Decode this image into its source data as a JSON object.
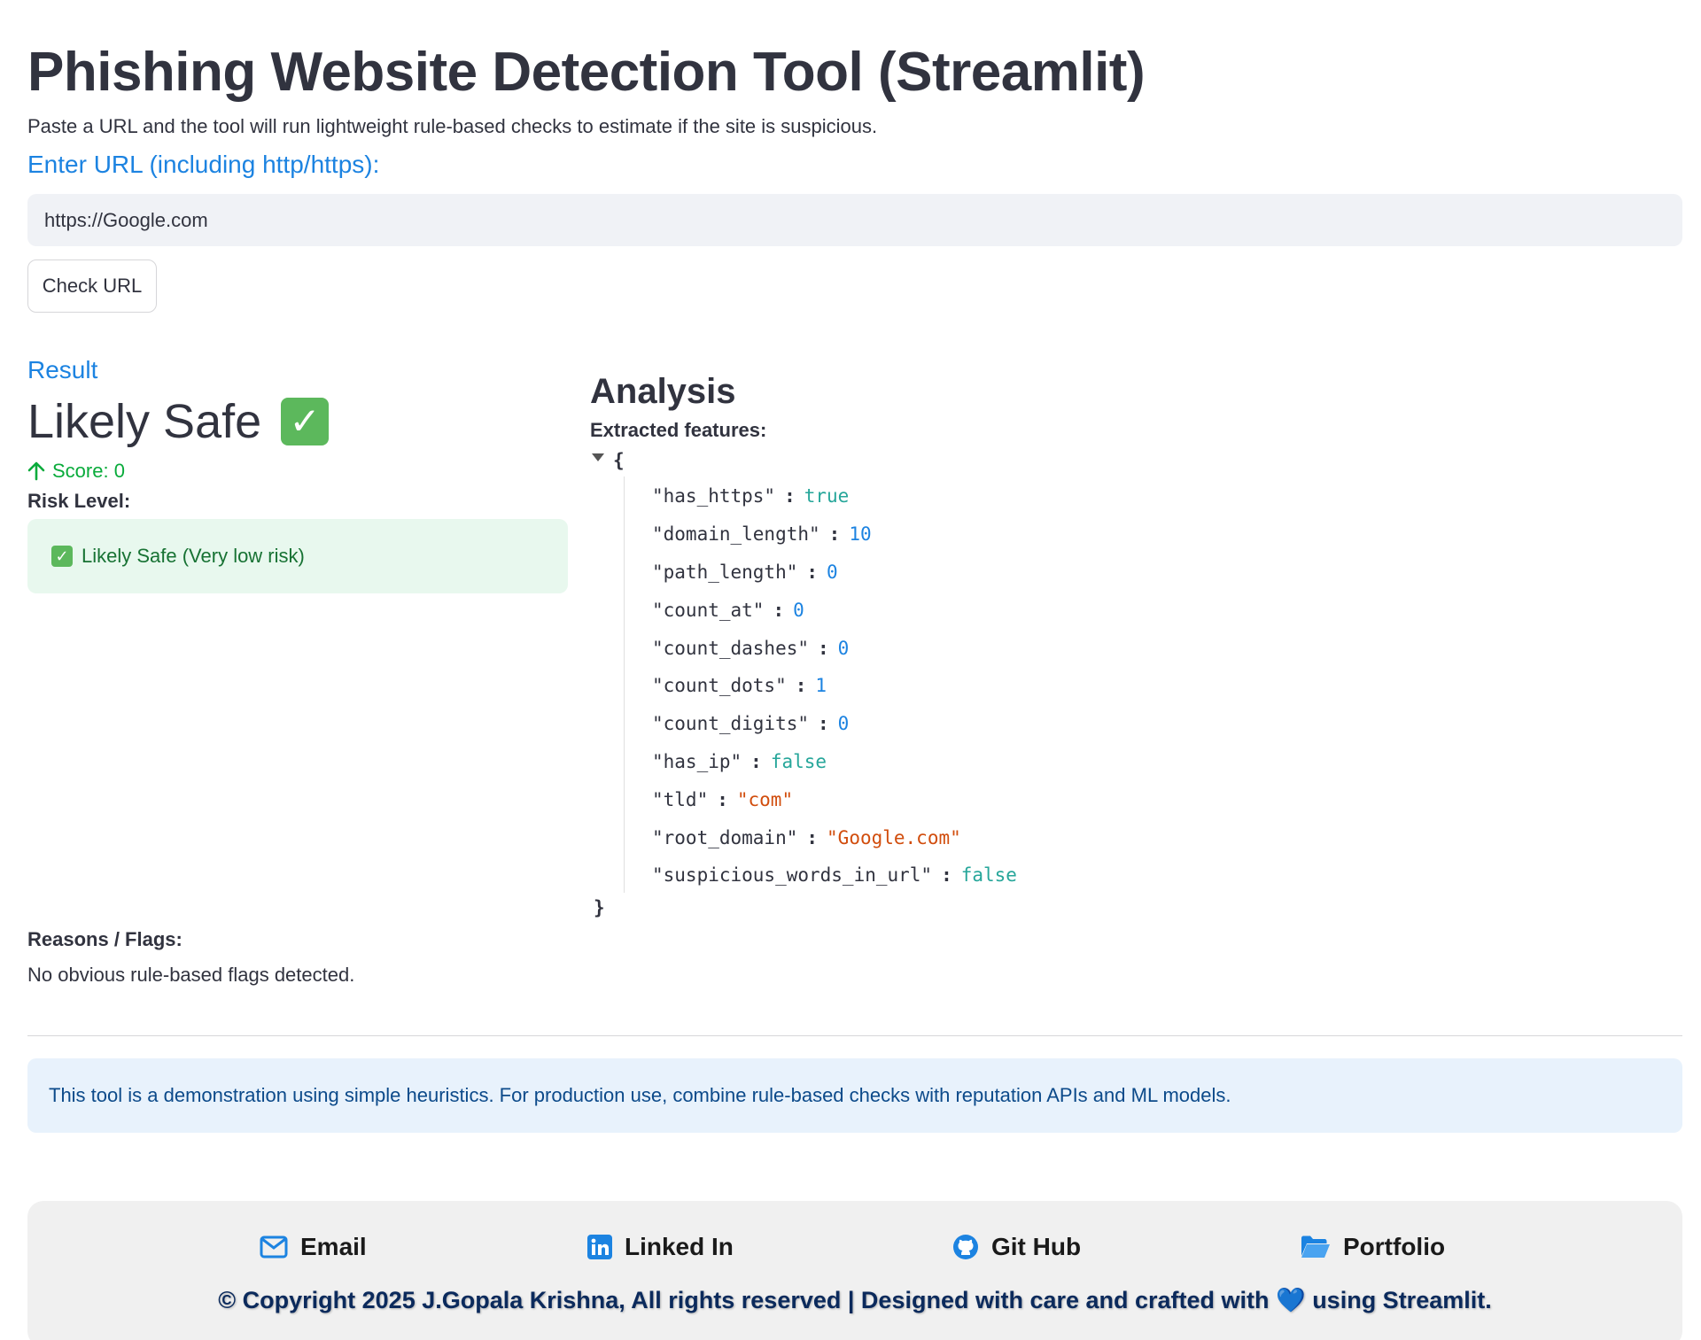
{
  "header": {
    "title": "Phishing Website Detection Tool (Streamlit)",
    "subtitle": "Paste a URL and the tool will run lightweight rule-based checks to estimate if the site is suspicious."
  },
  "url_input": {
    "label": "Enter URL (including http/https):",
    "value": "https://Google.com"
  },
  "check_button": {
    "label": "Check URL"
  },
  "result": {
    "label": "Result",
    "value": "Likely Safe",
    "score": "Score: 0",
    "risk_label": "Risk Level:",
    "risk_text": "Likely Safe (Very low risk)"
  },
  "analysis": {
    "title": "Analysis",
    "features_label": "Extracted features:",
    "features": [
      {
        "key": "\"has_https\"",
        "value": "true",
        "type": "bool"
      },
      {
        "key": "\"domain_length\"",
        "value": "10",
        "type": "num"
      },
      {
        "key": "\"path_length\"",
        "value": "0",
        "type": "num"
      },
      {
        "key": "\"count_at\"",
        "value": "0",
        "type": "num"
      },
      {
        "key": "\"count_dashes\"",
        "value": "0",
        "type": "num"
      },
      {
        "key": "\"count_dots\"",
        "value": "1",
        "type": "num"
      },
      {
        "key": "\"count_digits\"",
        "value": "0",
        "type": "num"
      },
      {
        "key": "\"has_ip\"",
        "value": "false",
        "type": "bool"
      },
      {
        "key": "\"tld\"",
        "value": "\"com\"",
        "type": "str"
      },
      {
        "key": "\"root_domain\"",
        "value": "\"Google.com\"",
        "type": "str"
      },
      {
        "key": "\"suspicious_words_in_url\"",
        "value": "false",
        "type": "bool"
      }
    ]
  },
  "reasons": {
    "label": "Reasons / Flags:",
    "text": "No obvious rule-based flags detected."
  },
  "info": {
    "text": "This tool is a demonstration using simple heuristics. For production use, combine rule-based checks with reputation APIs and ML models."
  },
  "footer": {
    "links": [
      {
        "label": "Email",
        "icon": "envelope-icon"
      },
      {
        "label": "Linked In",
        "icon": "linkedin-icon"
      },
      {
        "label": "Git Hub",
        "icon": "github-icon"
      },
      {
        "label": "Portfolio",
        "icon": "folder-open-icon"
      }
    ],
    "copyright_before": "© Copyright 2025 J.Gopala Krishna, All rights reserved | Designed with care and crafted with",
    "copyright_after": "using Streamlit."
  },
  "colors": {
    "accent": "#1c83e1",
    "success": "#09ab3b",
    "success_bg": "#e8f8ee",
    "info_bg": "#e8f2fc"
  }
}
